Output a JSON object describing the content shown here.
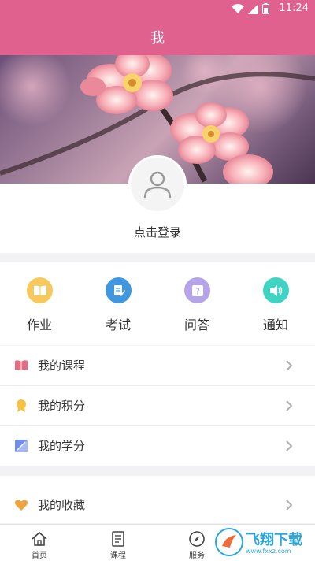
{
  "status_bar": {
    "time": "11:24"
  },
  "header": {
    "title": "我"
  },
  "profile": {
    "login_text": "点击登录"
  },
  "quick_actions": [
    {
      "label": "作业",
      "icon": "book-icon",
      "color": "#f7c85c"
    },
    {
      "label": "考试",
      "icon": "exam-icon",
      "color": "#3f97e0"
    },
    {
      "label": "问答",
      "icon": "question-icon",
      "color": "#b6a4e8"
    },
    {
      "label": "通知",
      "icon": "speaker-icon",
      "color": "#3fd3c4"
    }
  ],
  "menu": [
    {
      "label": "我的课程",
      "icon": "book-icon",
      "color": "#e86b7f"
    },
    {
      "label": "我的积分",
      "icon": "medal-icon",
      "color": "#f5c243"
    },
    {
      "label": "我的学分",
      "icon": "credit-icon",
      "color": "#6f8ef0"
    },
    {
      "label": "我的收藏",
      "icon": "heart-icon",
      "color": "#f0a23c"
    }
  ],
  "tabs": [
    {
      "label": "首页",
      "icon": "home-icon"
    },
    {
      "label": "课程",
      "icon": "course-icon"
    },
    {
      "label": "服务",
      "icon": "compass-icon"
    }
  ],
  "watermark": {
    "text": "飞翔下载",
    "url": "www.fxxz.com"
  },
  "colors": {
    "accent": "#e0608e",
    "divider": "#ececec"
  }
}
